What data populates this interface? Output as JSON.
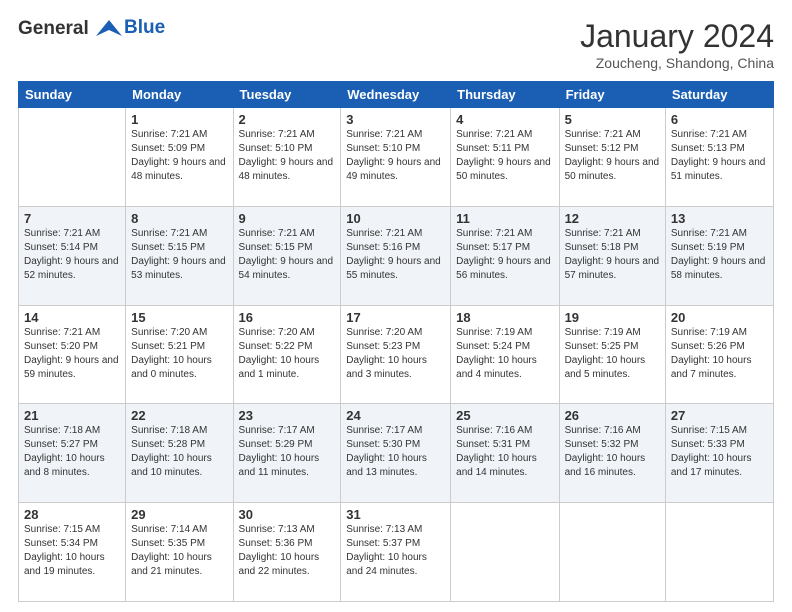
{
  "header": {
    "logo_line1": "General",
    "logo_line2": "Blue",
    "month_title": "January 2024",
    "location": "Zoucheng, Shandong, China"
  },
  "days_of_week": [
    "Sunday",
    "Monday",
    "Tuesday",
    "Wednesday",
    "Thursday",
    "Friday",
    "Saturday"
  ],
  "weeks": [
    [
      {
        "num": "",
        "sunrise": "",
        "sunset": "",
        "daylight": ""
      },
      {
        "num": "1",
        "sunrise": "7:21 AM",
        "sunset": "5:09 PM",
        "daylight": "9 hours and 48 minutes."
      },
      {
        "num": "2",
        "sunrise": "7:21 AM",
        "sunset": "5:10 PM",
        "daylight": "9 hours and 48 minutes."
      },
      {
        "num": "3",
        "sunrise": "7:21 AM",
        "sunset": "5:10 PM",
        "daylight": "9 hours and 49 minutes."
      },
      {
        "num": "4",
        "sunrise": "7:21 AM",
        "sunset": "5:11 PM",
        "daylight": "9 hours and 50 minutes."
      },
      {
        "num": "5",
        "sunrise": "7:21 AM",
        "sunset": "5:12 PM",
        "daylight": "9 hours and 50 minutes."
      },
      {
        "num": "6",
        "sunrise": "7:21 AM",
        "sunset": "5:13 PM",
        "daylight": "9 hours and 51 minutes."
      }
    ],
    [
      {
        "num": "7",
        "sunrise": "7:21 AM",
        "sunset": "5:14 PM",
        "daylight": "9 hours and 52 minutes."
      },
      {
        "num": "8",
        "sunrise": "7:21 AM",
        "sunset": "5:15 PM",
        "daylight": "9 hours and 53 minutes."
      },
      {
        "num": "9",
        "sunrise": "7:21 AM",
        "sunset": "5:15 PM",
        "daylight": "9 hours and 54 minutes."
      },
      {
        "num": "10",
        "sunrise": "7:21 AM",
        "sunset": "5:16 PM",
        "daylight": "9 hours and 55 minutes."
      },
      {
        "num": "11",
        "sunrise": "7:21 AM",
        "sunset": "5:17 PM",
        "daylight": "9 hours and 56 minutes."
      },
      {
        "num": "12",
        "sunrise": "7:21 AM",
        "sunset": "5:18 PM",
        "daylight": "9 hours and 57 minutes."
      },
      {
        "num": "13",
        "sunrise": "7:21 AM",
        "sunset": "5:19 PM",
        "daylight": "9 hours and 58 minutes."
      }
    ],
    [
      {
        "num": "14",
        "sunrise": "7:21 AM",
        "sunset": "5:20 PM",
        "daylight": "9 hours and 59 minutes."
      },
      {
        "num": "15",
        "sunrise": "7:20 AM",
        "sunset": "5:21 PM",
        "daylight": "10 hours and 0 minutes."
      },
      {
        "num": "16",
        "sunrise": "7:20 AM",
        "sunset": "5:22 PM",
        "daylight": "10 hours and 1 minute."
      },
      {
        "num": "17",
        "sunrise": "7:20 AM",
        "sunset": "5:23 PM",
        "daylight": "10 hours and 3 minutes."
      },
      {
        "num": "18",
        "sunrise": "7:19 AM",
        "sunset": "5:24 PM",
        "daylight": "10 hours and 4 minutes."
      },
      {
        "num": "19",
        "sunrise": "7:19 AM",
        "sunset": "5:25 PM",
        "daylight": "10 hours and 5 minutes."
      },
      {
        "num": "20",
        "sunrise": "7:19 AM",
        "sunset": "5:26 PM",
        "daylight": "10 hours and 7 minutes."
      }
    ],
    [
      {
        "num": "21",
        "sunrise": "7:18 AM",
        "sunset": "5:27 PM",
        "daylight": "10 hours and 8 minutes."
      },
      {
        "num": "22",
        "sunrise": "7:18 AM",
        "sunset": "5:28 PM",
        "daylight": "10 hours and 10 minutes."
      },
      {
        "num": "23",
        "sunrise": "7:17 AM",
        "sunset": "5:29 PM",
        "daylight": "10 hours and 11 minutes."
      },
      {
        "num": "24",
        "sunrise": "7:17 AM",
        "sunset": "5:30 PM",
        "daylight": "10 hours and 13 minutes."
      },
      {
        "num": "25",
        "sunrise": "7:16 AM",
        "sunset": "5:31 PM",
        "daylight": "10 hours and 14 minutes."
      },
      {
        "num": "26",
        "sunrise": "7:16 AM",
        "sunset": "5:32 PM",
        "daylight": "10 hours and 16 minutes."
      },
      {
        "num": "27",
        "sunrise": "7:15 AM",
        "sunset": "5:33 PM",
        "daylight": "10 hours and 17 minutes."
      }
    ],
    [
      {
        "num": "28",
        "sunrise": "7:15 AM",
        "sunset": "5:34 PM",
        "daylight": "10 hours and 19 minutes."
      },
      {
        "num": "29",
        "sunrise": "7:14 AM",
        "sunset": "5:35 PM",
        "daylight": "10 hours and 21 minutes."
      },
      {
        "num": "30",
        "sunrise": "7:13 AM",
        "sunset": "5:36 PM",
        "daylight": "10 hours and 22 minutes."
      },
      {
        "num": "31",
        "sunrise": "7:13 AM",
        "sunset": "5:37 PM",
        "daylight": "10 hours and 24 minutes."
      },
      {
        "num": "",
        "sunrise": "",
        "sunset": "",
        "daylight": ""
      },
      {
        "num": "",
        "sunrise": "",
        "sunset": "",
        "daylight": ""
      },
      {
        "num": "",
        "sunrise": "",
        "sunset": "",
        "daylight": ""
      }
    ]
  ],
  "labels": {
    "sunrise_prefix": "Sunrise: ",
    "sunset_prefix": "Sunset: ",
    "daylight_prefix": "Daylight: "
  }
}
